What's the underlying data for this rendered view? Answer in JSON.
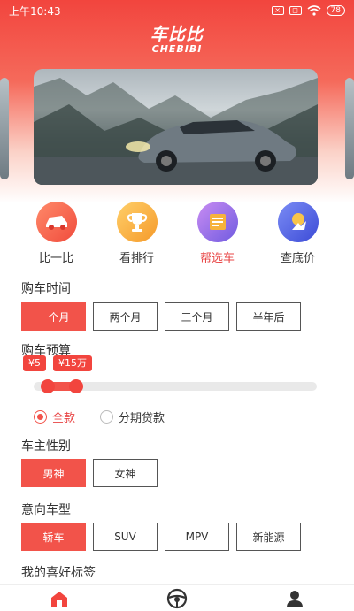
{
  "status_bar": {
    "time": "上午10:43",
    "battery": "78"
  },
  "logo": {
    "cn": "车比比",
    "en": "CHEBIBI"
  },
  "menu": [
    {
      "label": "比一比",
      "icon": "car-compare-icon",
      "active": false
    },
    {
      "label": "看排行",
      "icon": "trophy-icon",
      "active": false
    },
    {
      "label": "帮选车",
      "icon": "checklist-icon",
      "active": true
    },
    {
      "label": "查底价",
      "icon": "price-tag-icon",
      "active": false
    }
  ],
  "purchase_time": {
    "title": "购车时间",
    "options": [
      "一个月",
      "两个月",
      "三个月",
      "半年后"
    ],
    "selected": "一个月"
  },
  "budget": {
    "title": "购车预算",
    "min_label": "¥5",
    "max_label": "¥15万",
    "min_fraction": 0.05,
    "max_fraction": 0.15
  },
  "payment": {
    "options": [
      "全款",
      "分期贷款"
    ],
    "selected": "全款"
  },
  "gender": {
    "title": "车主性别",
    "options": [
      "男神",
      "女神"
    ],
    "selected": "男神"
  },
  "car_type": {
    "title": "意向车型",
    "options": [
      "轿车",
      "SUV",
      "MPV",
      "新能源"
    ],
    "selected": "轿车"
  },
  "tags": {
    "title": "我的喜好标签"
  },
  "colors": {
    "accent": "#f2534a",
    "brand_red": "#f2453e"
  }
}
